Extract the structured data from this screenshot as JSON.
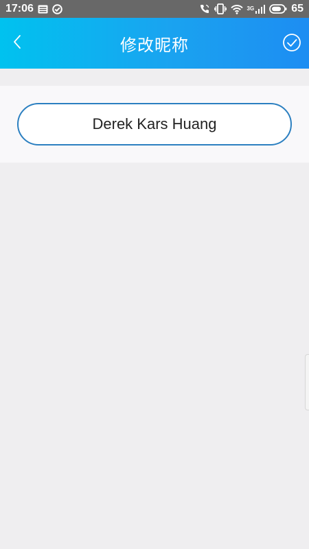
{
  "status_bar": {
    "time": "17:06",
    "network_label": "3G",
    "battery_level": "65",
    "icons": [
      "news-icon",
      "check-circle-icon",
      "call-icon",
      "vibrate-icon",
      "wifi-icon",
      "signal-icon",
      "battery-icon"
    ]
  },
  "header": {
    "title": "修改昵称",
    "back_icon": "chevron-left-icon",
    "confirm_icon": "check-circle-icon"
  },
  "nickname": {
    "value": "Derek Kars Huang"
  },
  "colors": {
    "status_bar_bg": "#686868",
    "header_gradient_start": "#00c2ef",
    "header_gradient_end": "#1d8df2",
    "input_border": "#2b7fc0",
    "page_bg": "#efeef0"
  }
}
